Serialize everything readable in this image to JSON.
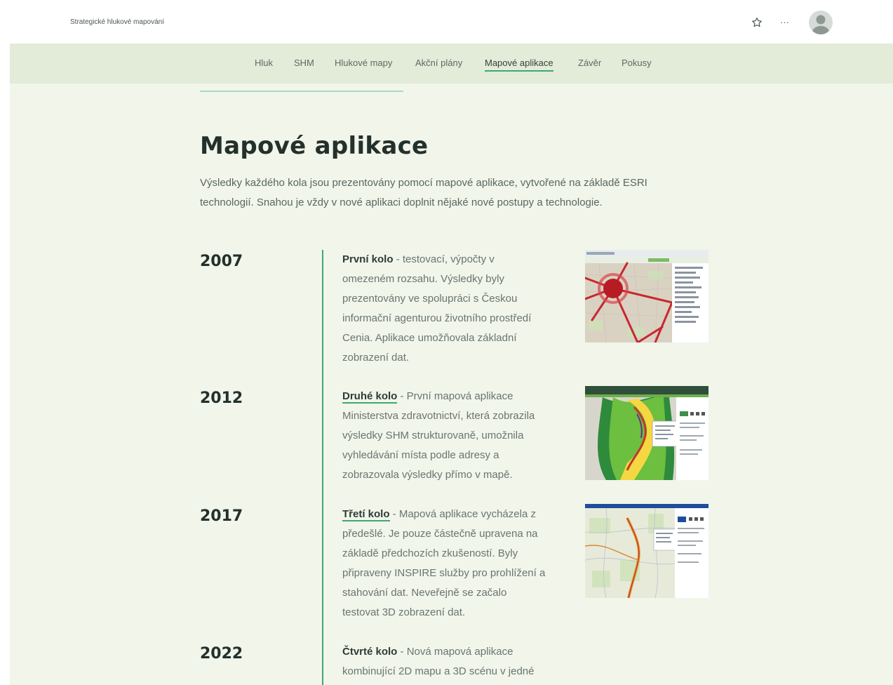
{
  "header": {
    "site_title": "Strategické hlukové mapování",
    "more_label": "···"
  },
  "nav": {
    "items": [
      {
        "label": "Hluk"
      },
      {
        "label": "SHM"
      },
      {
        "label": "Hlukové mapy"
      },
      {
        "label": "Akční plány"
      },
      {
        "label": "Mapové aplikace",
        "active": true
      },
      {
        "label": "Závěr"
      },
      {
        "label": "Pokusy"
      }
    ]
  },
  "main": {
    "title": "Mapové aplikace",
    "intro_line1": "Výsledky každého kola jsou prezentovány pomocí mapové aplikace, vytvořené na základě ESRI",
    "intro_line2": "technologií. Snahou je vždy v nové aplikaci doplnit nějaké nové postupy a technologie."
  },
  "timeline": [
    {
      "year": "2007",
      "lead": "První kolo",
      "lines": [
        " - testovací, výpočty v",
        "omezeném rozsahu. Výsledky byly",
        "prezentovány ve spolupráci s Českou",
        "informační agenturou životního prostředí",
        "Cenia. Aplikace umožňovala základní",
        "zobrazení dat."
      ]
    },
    {
      "year": "2012",
      "lead": "Druhé kolo",
      "lines": [
        " - První mapová aplikace",
        "Ministerstva zdravotnictví, která zobrazila",
        "výsledky SHM strukturovaně, umožnila",
        "vyhledávání místa podle adresy a",
        "zobrazovala výsledky přímo v mapě."
      ]
    },
    {
      "year": "2017",
      "lead": "Třetí kolo",
      "lines": [
        " - Mapová aplikace vycházela z",
        "předešlé. Je pouze částečně upravena na",
        "základě předchozích zkušeností. Byly",
        "připraveny INSPIRE služby pro prohlížení a",
        "stahování dat. Neveřejně se začalo",
        "testovat 3D zobrazení dat."
      ]
    },
    {
      "year": "2022",
      "lead": "Čtvrté kolo",
      "lines": [
        " - Nová mapová aplikace",
        "kombinující 2D mapu a 3D scénu v jedné"
      ]
    }
  ],
  "colors": {
    "accent": "#3fa873",
    "page_bg": "#f1f5ea",
    "nav_bg": "#e3ebd9",
    "heading": "#23302b"
  },
  "icons": {
    "favorite": "star-outline-icon",
    "more": "ellipsis-icon",
    "profile": "user-avatar-icon"
  }
}
